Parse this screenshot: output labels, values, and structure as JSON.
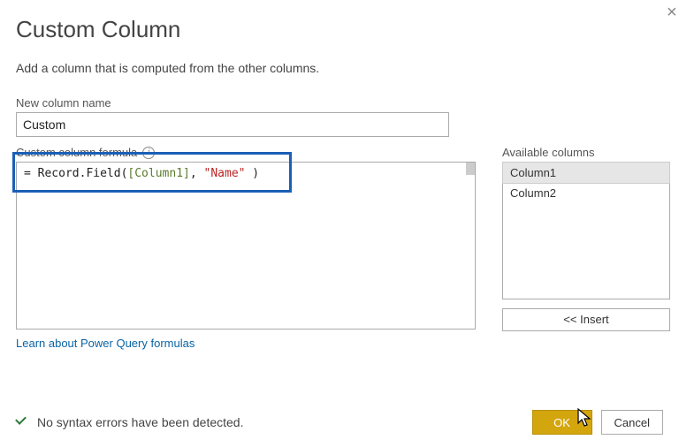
{
  "dialog": {
    "title": "Custom Column",
    "subtitle": "Add a column that is computed from the other columns."
  },
  "newColumn": {
    "label": "New column name",
    "value": "Custom"
  },
  "formula": {
    "label": "Custom column formula",
    "prefix": "= ",
    "fn": "Record.Field",
    "open": "(",
    "col": "[Column1]",
    "sep": ", ",
    "str": "\"Name\"",
    "close": " )"
  },
  "available": {
    "label": "Available columns",
    "items": [
      "Column1",
      "Column2"
    ],
    "selectedIndex": 0,
    "insertLabel": "<< Insert"
  },
  "learnLink": "Learn about Power Query formulas",
  "status": "No syntax errors have been detected.",
  "buttons": {
    "ok": "OK",
    "cancel": "Cancel"
  }
}
